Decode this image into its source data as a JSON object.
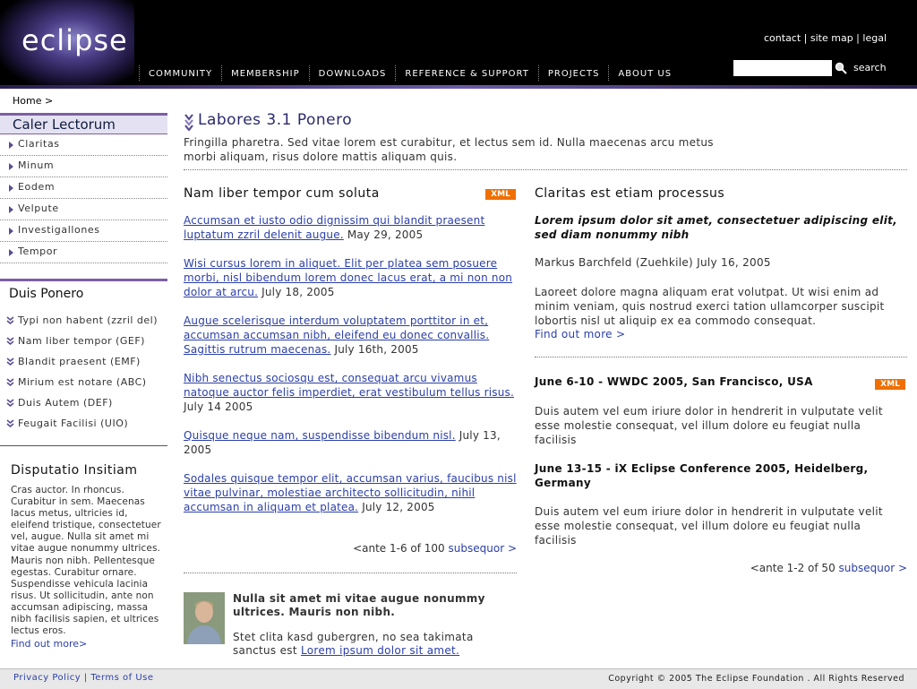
{
  "header": {
    "logo": "eclipse",
    "util_links": [
      "contact",
      "site map",
      "legal"
    ],
    "nav": [
      "COMMUNITY",
      "MEMBERSHIP",
      "DOWNLOADS",
      "REFERENCE & SUPPORT",
      "PROJECTS",
      "ABOUT US"
    ],
    "search_label": "search",
    "search_value": ""
  },
  "breadcrumb": "Home >",
  "sidebar": {
    "section1_title": "Caler Lectorum",
    "section1_items": [
      "Claritas",
      "Minum",
      "Eodem",
      "Velpute",
      "Investigallones",
      "Tempor"
    ],
    "section2_title": "Duis Ponero",
    "section2_items": [
      "Typi non habent (zzril del)",
      "Nam liber tempor (GEF)",
      "Blandit praesent (EMF)",
      "Mirium est notare (ABC)",
      "Duis Autem (DEF)",
      "Feugait Facilisi (UIO)"
    ],
    "section3_title": "Disputatio Insitiam",
    "section3_text": "Cras auctor. In rhoncus. Curabitur in sem. Maecenas lacus metus, ultricies id, eleifend tristique, consectetuer vel, augue. Nulla sit amet mi vitae augue nonummy ultrices. Mauris non nibh. Pellentesque egestas. Curabitur ornare. Suspendisse vehicula lacinia risus. Ut sollicitudin, ante non accumsan adipiscing, massa nibh facilisis sapien, et ultrices lectus eros.",
    "section3_link": "Find out more>"
  },
  "main": {
    "title": "Labores 3.1 Ponero",
    "intro": "Fringilla pharetra. Sed vitae lorem est curabitur, et lectus sem id. Nulla maecenas arcu metus morbi aliquam, risus dolore mattis aliquam quis.",
    "col1": {
      "title": "Nam liber tempor cum soluta",
      "xml_badge": "XML",
      "items": [
        {
          "link": "Accumsan et iusto odio dignissim qui blandit praesent luptatum zzril delenit augue.",
          "date": " May 29, 2005"
        },
        {
          "link": "Wisi cursus lorem in aliquet. Elit per platea sem posuere morbi, nisl bibendum lorem donec lacus erat, a mi non non dolor at arcu.",
          "date": " July 18, 2005"
        },
        {
          "link": "Augue scelerisque interdum voluptatem porttitor in et, accumsan accumsan nibh, eleifend eu donec convallis. Sagittis rutrum maecenas.",
          "date": " July 16th, 2005"
        },
        {
          "link": "Nibh senectus sociosqu est, consequat arcu vivamus natoque auctor felis imperdiet, erat vestibulum tellus risus.",
          "date": " July 14 2005"
        },
        {
          "link": "Quisque neque nam, suspendisse bibendum nisl.",
          "date": " July 13, 2005"
        },
        {
          "link": "Sodales quisque tempor elit, accumsan varius, faucibus nisl vitae pulvinar, molestiae architecto sollicitudin, nihil accumsan in aliquam et platea.",
          "date": " July 12, 2005"
        }
      ],
      "pager_text": "<ante 1-6 of 100 ",
      "pager_link": "subsequor >",
      "profile_quote": "Nulla sit amet mi vitae augue nonummy ultrices. Mauris non nibh.",
      "profile_text": "Stet clita kasd gubergren, no sea takimata sanctus est ",
      "profile_link": "Lorem ipsum dolor sit amet."
    },
    "col2": {
      "title": "Claritas est etiam processus",
      "lead": "Lorem ipsum dolor sit amet, consectetuer adipiscing elit, sed diam nonummy nibh",
      "author": "Markus Barchfeld (Zuehkile) July 16, 2005",
      "body": "Laoreet dolore magna aliquam erat volutpat. Ut wisi enim ad minim veniam, quis nostrud exerci tation ullamcorper suscipit lobortis nisl ut aliquip ex ea commodo consequat.",
      "more": "Find out more >",
      "xml_badge": "XML",
      "event1_title": "June 6-10 - WWDC 2005, San Francisco, USA",
      "event1_body": "Duis autem vel eum iriure dolor in hendrerit in vulputate velit esse molestie consequat, vel illum dolore eu feugiat nulla facilisis",
      "event2_title": "June 13-15 - iX Eclipse Conference 2005, Heidelberg, Germany",
      "event2_body": "Duis autem vel eum iriure dolor in hendrerit in vulputate velit esse molestie consequat, vel illum dolore eu feugiat nulla facilisis",
      "pager_text": "<ante 1-2 of 50 ",
      "pager_link": "subsequor >"
    }
  },
  "footer": {
    "privacy": "Privacy Policy",
    "terms": "Terms of Use",
    "copyright": "Copyright © 2005  The Eclipse Foundation . All Rights Reserved"
  }
}
